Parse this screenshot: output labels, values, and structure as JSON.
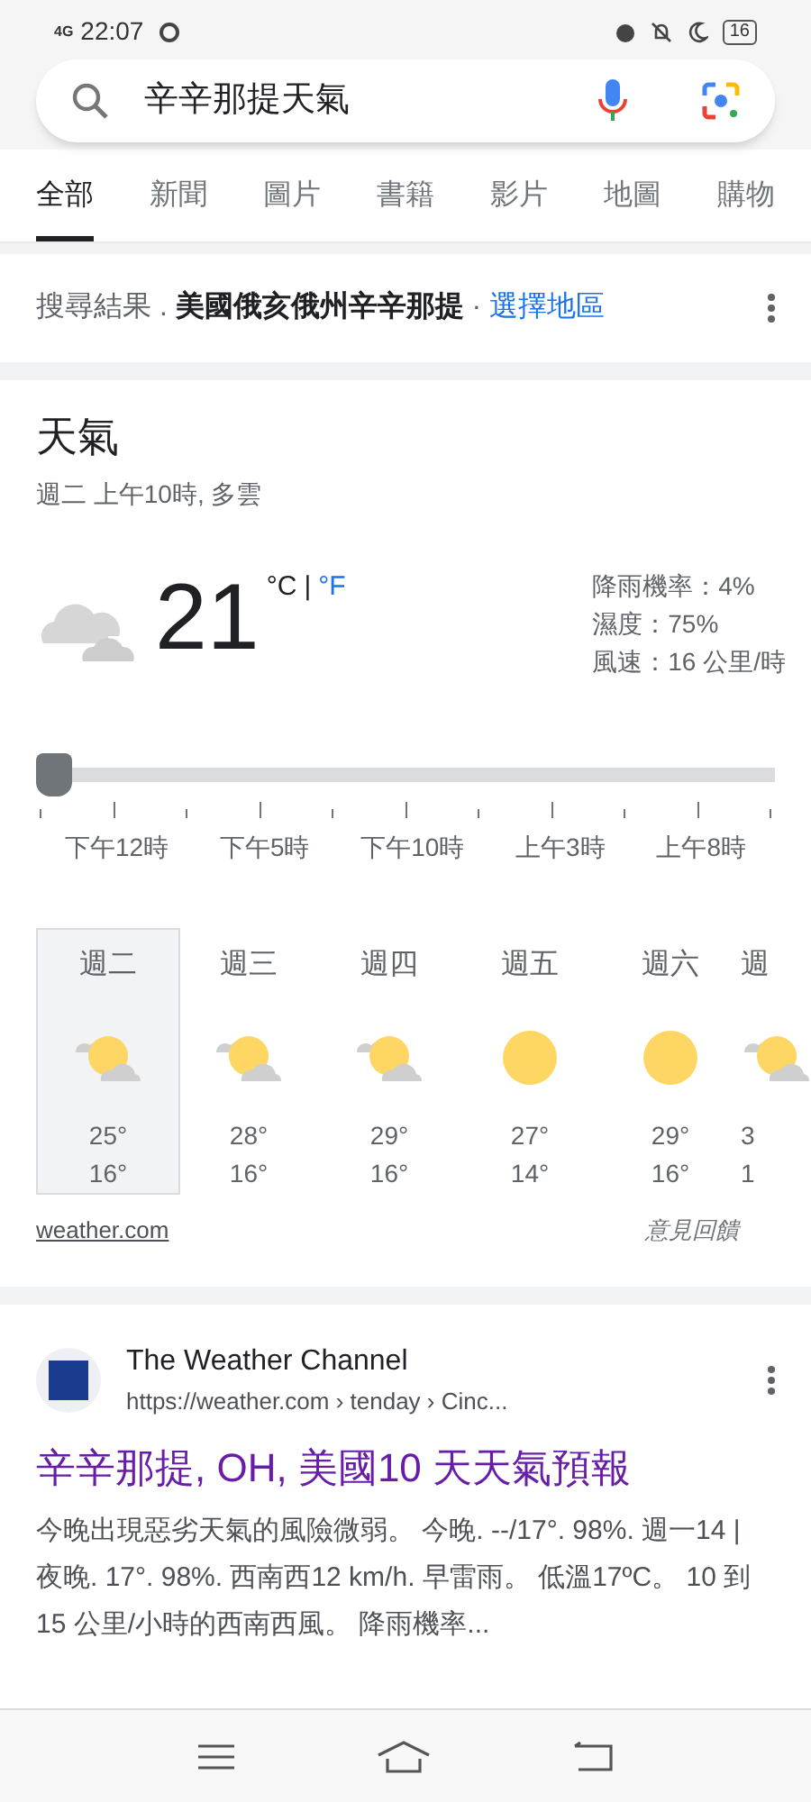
{
  "status_bar": {
    "network": "4G",
    "time": "22:07",
    "battery": "16"
  },
  "search": {
    "value": "辛辛那提天氣"
  },
  "tabs": [
    {
      "label": "全部",
      "selected": true
    },
    {
      "label": "新聞",
      "selected": false
    },
    {
      "label": "圖片",
      "selected": false
    },
    {
      "label": "書籍",
      "selected": false
    },
    {
      "label": "影片",
      "selected": false
    },
    {
      "label": "地圖",
      "selected": false
    },
    {
      "label": "購物",
      "selected": false
    }
  ],
  "results_for": {
    "prefix": "搜尋結果 .",
    "location": "美國俄亥俄州辛辛那提",
    "separator": "·",
    "link": "選擇地區"
  },
  "weather": {
    "title": "天氣",
    "subtitle": "週二 上午10時, 多雲",
    "temperature": "21",
    "unit_c": "°C",
    "unit_sep": "|",
    "unit_f": "°F",
    "details": [
      "降雨機率：4%",
      "濕度：75%",
      "風速：16 公里/時"
    ],
    "slider": {
      "level": 0
    },
    "hours": [
      "下午12時",
      "下午5時",
      "下午10時",
      "上午3時",
      "上午8時"
    ],
    "days": [
      {
        "day": "週二",
        "kind": "partly_cloudy",
        "high": "25°",
        "low": "16°",
        "selected": true
      },
      {
        "day": "週三",
        "kind": "partly_cloudy",
        "high": "28°",
        "low": "16°",
        "selected": false
      },
      {
        "day": "週四",
        "kind": "partly_cloudy",
        "high": "29°",
        "low": "16°",
        "selected": false
      },
      {
        "day": "週五",
        "kind": "sunny",
        "high": "27°",
        "low": "14°",
        "selected": false
      },
      {
        "day": "週六",
        "kind": "sunny",
        "high": "29°",
        "low": "16°",
        "selected": false
      },
      {
        "day": "週",
        "kind": "partly_cloudy",
        "high": "3",
        "low": "1",
        "selected": false
      }
    ],
    "source": "weather.com",
    "feedback": "意見回饋"
  },
  "result": {
    "site": "The Weather Channel",
    "url": "https://weather.com › tenday › Cinc...",
    "title": "辛辛那提, OH, 美國10 天天氣預報",
    "snippet": "今晚出現惡劣天氣的風險微弱。 今晚. --/17°. 98%. 週一14 | 夜晚. 17°. 98%. 西南西12 km/h. 早雷雨。 低溫17ºC。 10 到15 公里/小時的西南西風。 降雨機率..."
  }
}
